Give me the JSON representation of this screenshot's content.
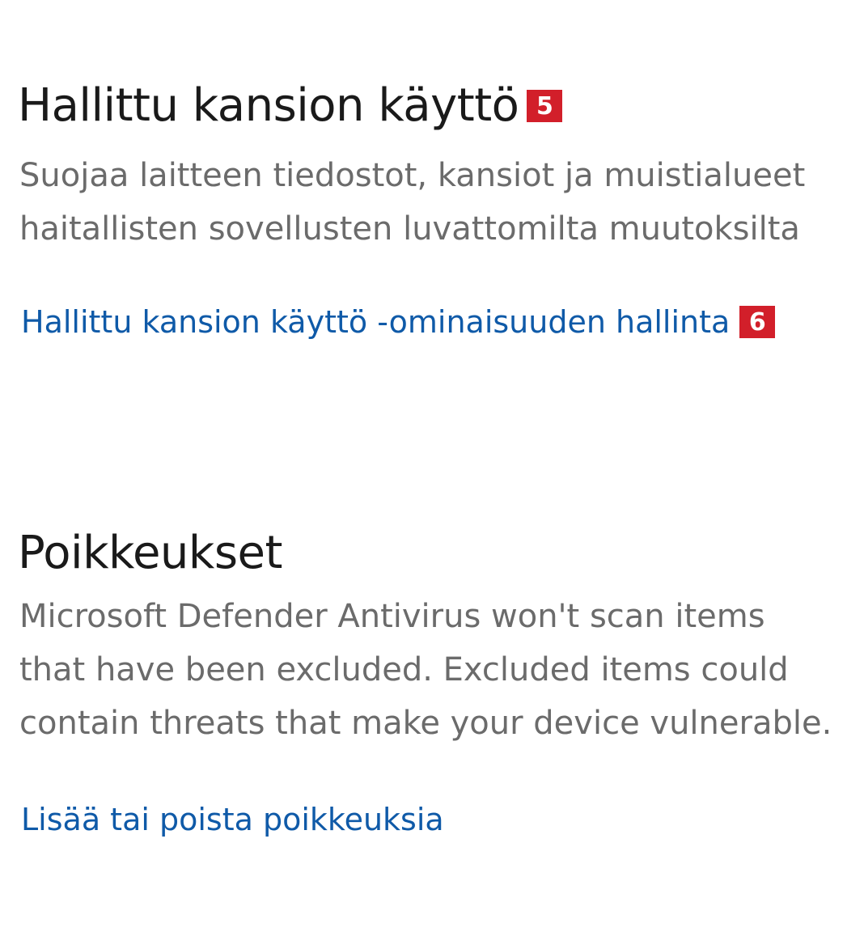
{
  "controlled_folder_access": {
    "title": "Hallittu kansion käyttö",
    "title_badge": "5",
    "description_lines": [
      "Suojaa laitteen tiedostot, kansiot ja muistialueet",
      "haitallisten sovellusten luvattomilta muutoksilta"
    ],
    "link_label": "Hallittu kansion käyttö -ominaisuuden hallinta",
    "link_badge": "6"
  },
  "exclusions": {
    "title": "Poikkeukset",
    "description_lines": [
      "Microsoft Defender Antivirus won't scan items",
      "that have been excluded. Excluded items could",
      "contain threats that make your device vulnerable."
    ],
    "link_label": "Lisää tai poista poikkeuksia"
  },
  "colors": {
    "heading": "#1a1a1a",
    "description": "#6b6b6b",
    "link": "#0f5aa8",
    "badge": "#d21f2a"
  }
}
